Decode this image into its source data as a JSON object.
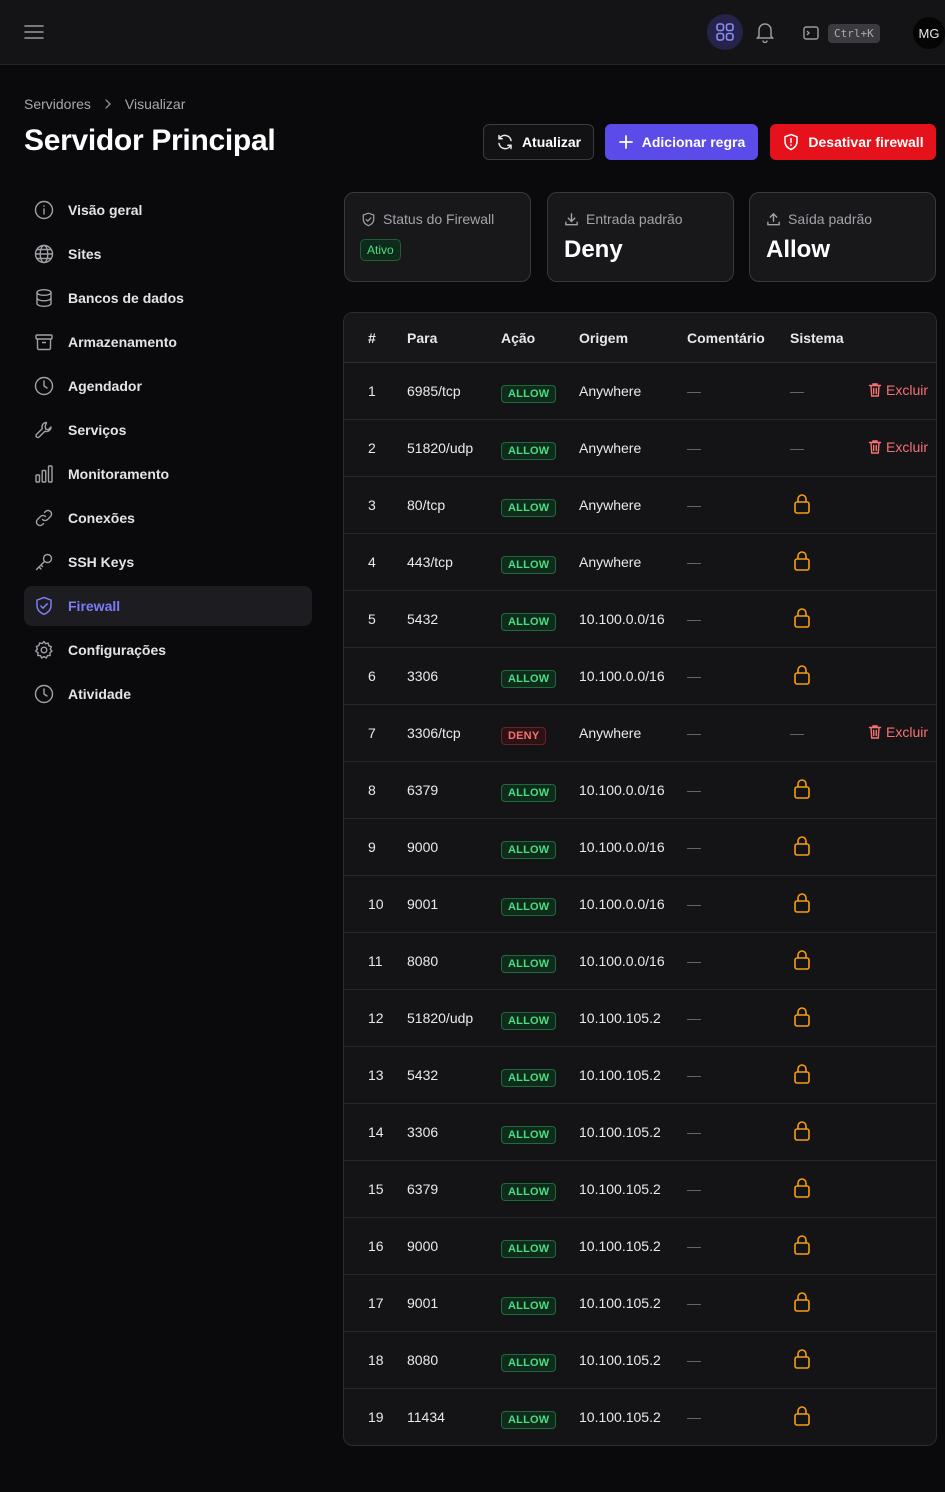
{
  "header": {
    "kbd_shortcut": "Ctrl+K",
    "avatar_initials": "MG"
  },
  "breadcrumb": {
    "items": [
      "Servidores",
      "Visualizar"
    ]
  },
  "page_title": "Servidor Principal",
  "actions": {
    "refresh": "Atualizar",
    "add_rule": "Adicionar regra",
    "disable_firewall": "Desativar firewall"
  },
  "sidebar": {
    "items": [
      {
        "label": "Visão geral",
        "icon": "info-icon"
      },
      {
        "label": "Sites",
        "icon": "globe-icon"
      },
      {
        "label": "Bancos de dados",
        "icon": "database-icon"
      },
      {
        "label": "Armazenamento",
        "icon": "archive-icon"
      },
      {
        "label": "Agendador",
        "icon": "clock-icon"
      },
      {
        "label": "Serviços",
        "icon": "wrench-icon"
      },
      {
        "label": "Monitoramento",
        "icon": "bar-chart-icon"
      },
      {
        "label": "Conexões",
        "icon": "link-icon"
      },
      {
        "label": "SSH Keys",
        "icon": "key-icon"
      },
      {
        "label": "Firewall",
        "icon": "shield-check-icon",
        "active": true
      },
      {
        "label": "Configurações",
        "icon": "gear-icon"
      },
      {
        "label": "Atividade",
        "icon": "clock-icon"
      }
    ]
  },
  "cards": {
    "status": {
      "label": "Status do Firewall",
      "badge": "Ativo"
    },
    "incoming": {
      "label": "Entrada padrão",
      "value": "Deny"
    },
    "outgoing": {
      "label": "Saída padrão",
      "value": "Allow"
    }
  },
  "table": {
    "headers": [
      "#",
      "Para",
      "Ação",
      "Origem",
      "Comentário",
      "Sistema"
    ],
    "dash": "—",
    "delete_label": "Excluir",
    "rows": [
      {
        "num": "1",
        "to": "6985/tcp",
        "action": "ALLOW",
        "origin": "Anywhere",
        "system": false
      },
      {
        "num": "2",
        "to": "51820/udp",
        "action": "ALLOW",
        "origin": "Anywhere",
        "system": false
      },
      {
        "num": "3",
        "to": "80/tcp",
        "action": "ALLOW",
        "origin": "Anywhere",
        "system": true
      },
      {
        "num": "4",
        "to": "443/tcp",
        "action": "ALLOW",
        "origin": "Anywhere",
        "system": true
      },
      {
        "num": "5",
        "to": "5432",
        "action": "ALLOW",
        "origin": "10.100.0.0/16",
        "system": true
      },
      {
        "num": "6",
        "to": "3306",
        "action": "ALLOW",
        "origin": "10.100.0.0/16",
        "system": true
      },
      {
        "num": "7",
        "to": "3306/tcp",
        "action": "DENY",
        "origin": "Anywhere",
        "system": false
      },
      {
        "num": "8",
        "to": "6379",
        "action": "ALLOW",
        "origin": "10.100.0.0/16",
        "system": true
      },
      {
        "num": "9",
        "to": "9000",
        "action": "ALLOW",
        "origin": "10.100.0.0/16",
        "system": true
      },
      {
        "num": "10",
        "to": "9001",
        "action": "ALLOW",
        "origin": "10.100.0.0/16",
        "system": true
      },
      {
        "num": "11",
        "to": "8080",
        "action": "ALLOW",
        "origin": "10.100.0.0/16",
        "system": true
      },
      {
        "num": "12",
        "to": "51820/udp",
        "action": "ALLOW",
        "origin": "10.100.105.2",
        "system": true
      },
      {
        "num": "13",
        "to": "5432",
        "action": "ALLOW",
        "origin": "10.100.105.2",
        "system": true
      },
      {
        "num": "14",
        "to": "3306",
        "action": "ALLOW",
        "origin": "10.100.105.2",
        "system": true
      },
      {
        "num": "15",
        "to": "6379",
        "action": "ALLOW",
        "origin": "10.100.105.2",
        "system": true
      },
      {
        "num": "16",
        "to": "9000",
        "action": "ALLOW",
        "origin": "10.100.105.2",
        "system": true
      },
      {
        "num": "17",
        "to": "9001",
        "action": "ALLOW",
        "origin": "10.100.105.2",
        "system": true
      },
      {
        "num": "18",
        "to": "8080",
        "action": "ALLOW",
        "origin": "10.100.105.2",
        "system": true
      },
      {
        "num": "19",
        "to": "11434",
        "action": "ALLOW",
        "origin": "10.100.105.2",
        "system": true
      }
    ]
  },
  "colors": {
    "accent": "#5b4be8",
    "danger": "#e5121b",
    "allow": "#4ade80",
    "deny": "#f87171",
    "lock": "#f59e0b"
  }
}
